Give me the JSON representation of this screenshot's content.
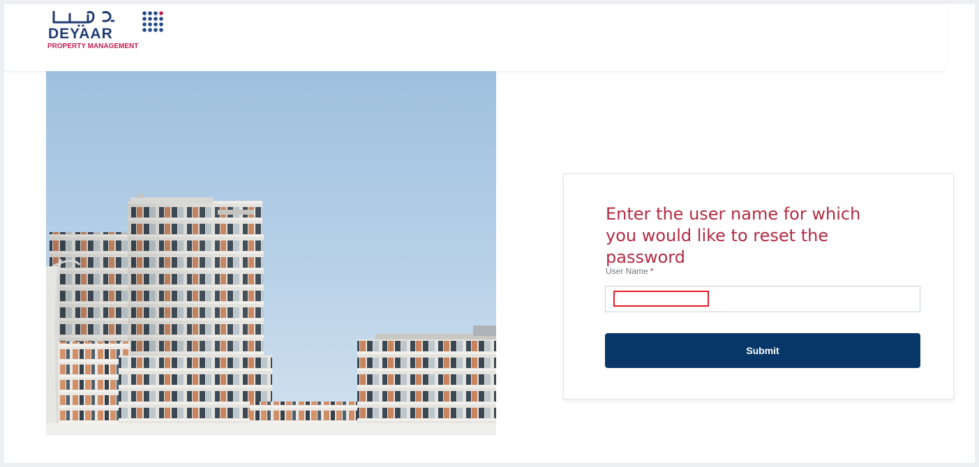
{
  "brand": {
    "arabic_name": "ديـــار",
    "name": "DEYAAR",
    "tagline": "PROPERTY MANAGEMENT",
    "colors": {
      "navy": "#203b70",
      "crimson": "#c21f4f",
      "mark_blue": "#224a89"
    }
  },
  "hero": {
    "image_name": "residential-towers-image"
  },
  "form": {
    "title": "Enter the user name for which you would like to reset the password",
    "username_label": "User Name",
    "required_marker": "*",
    "username_value": "",
    "submit_label": "Submit",
    "title_color": "#b22b42",
    "button_color": "#063768",
    "highlight_color": "#e41c25"
  }
}
